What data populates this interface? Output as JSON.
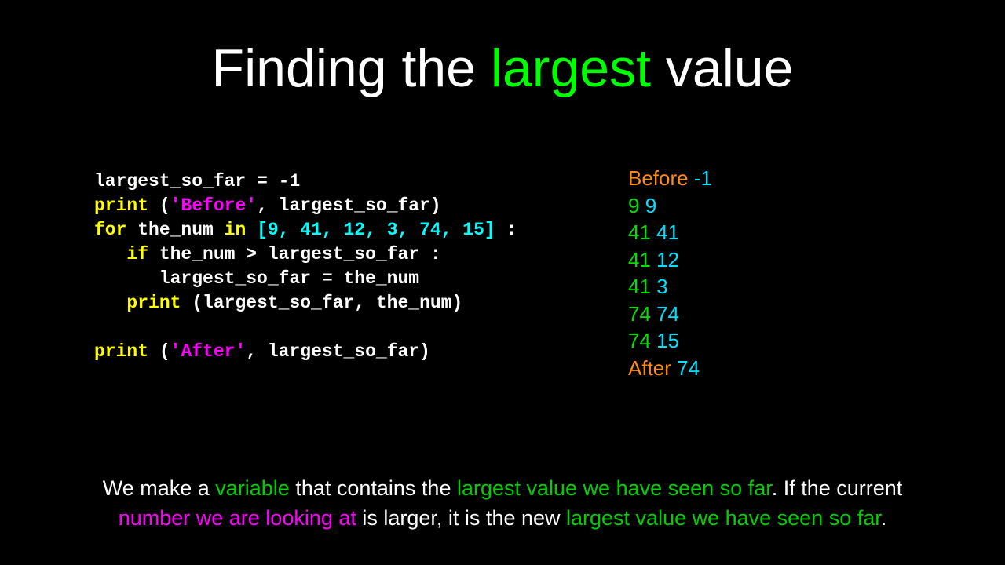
{
  "title": {
    "pre": "Finding the ",
    "highlight": "largest",
    "post": " value"
  },
  "code": {
    "l1": {
      "a": "largest_so_far = -1"
    },
    "l2": {
      "a": "print ",
      "b": "(",
      "c": "'Before'",
      "d": ", largest_so_far)"
    },
    "l3": {
      "a": "for ",
      "b": "the_num ",
      "c": "in ",
      "d": "[9, 41, 12, 3, 74, 15]",
      "e": " :"
    },
    "l4": {
      "a": "   if ",
      "b": "the_num > largest_so_far :"
    },
    "l5": {
      "a": "      largest_so_far = the_num"
    },
    "l6": {
      "a": "   print ",
      "b": "(largest_so_far, the_num)"
    },
    "l7": {
      "a": ""
    },
    "l8": {
      "a": "print ",
      "b": "(",
      "c": "'After'",
      "d": ", ",
      "e": "largest_so_far)"
    }
  },
  "output": {
    "r0": {
      "label": "Before ",
      "val": "-1"
    },
    "r1": {
      "a": "9 ",
      "b": "9"
    },
    "r2": {
      "a": "41 ",
      "b": "41"
    },
    "r3": {
      "a": "41 ",
      "b": "12"
    },
    "r4": {
      "a": "41 ",
      "b": "3"
    },
    "r5": {
      "a": "74 ",
      "b": "74"
    },
    "r6": {
      "a": "74 ",
      "b": "15"
    },
    "r7": {
      "label": "After ",
      "val": "74"
    }
  },
  "caption": {
    "p1": "We make a ",
    "p2": "variable",
    "p3": " that contains the ",
    "p4": "largest value we have seen so far",
    "p5": ". If the current ",
    "p6": "number we are looking at",
    "p7": " is larger, it is the new ",
    "p8": "largest value we have seen so far",
    "p9": "."
  }
}
